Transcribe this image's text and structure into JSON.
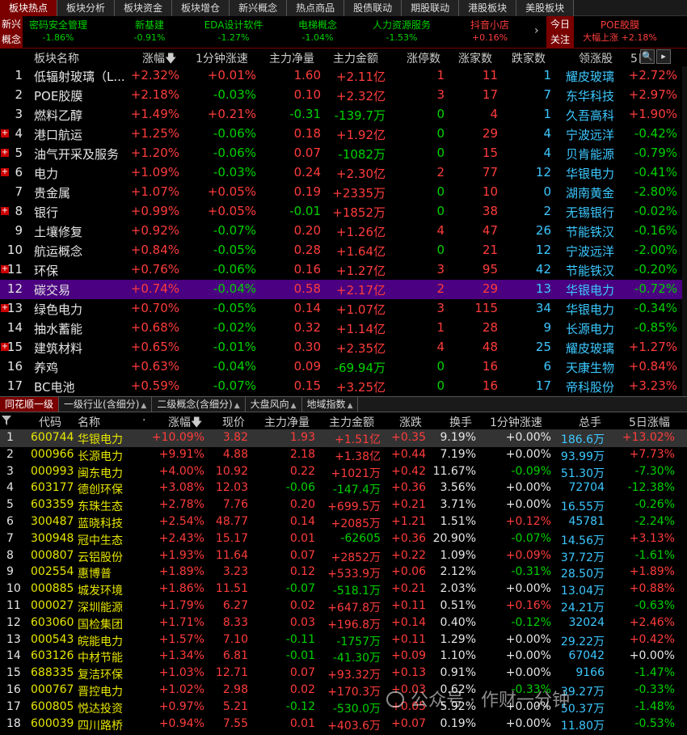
{
  "top_tabs": [
    "板块热点",
    "板块分析",
    "板块资金",
    "板块增仓",
    "新兴概念",
    "热点商品",
    "股债联动",
    "期股联动",
    "港股板块",
    "美股板块"
  ],
  "ticker": {
    "left_label_line1": "新兴",
    "left_label_line2": "概念",
    "items": [
      {
        "name": "密码安全管理",
        "value": "-1.86%"
      },
      {
        "name": "新基建",
        "value": "-0.91%"
      },
      {
        "name": "EDA设计软件",
        "value": "-1.27%"
      },
      {
        "name": "电梯概念",
        "value": "-1.04%"
      },
      {
        "name": "人力资源服务",
        "value": "-1.53%"
      },
      {
        "name": "抖音小店",
        "value": "+0.16%"
      }
    ],
    "right_label_line1": "今日",
    "right_label_line2": "关注",
    "hot_name": "POE胶膜",
    "hot_value": "大幅上涨 +2.18%"
  },
  "upper_headers": [
    "板块名称",
    "涨幅",
    "1分钟涨速",
    "主力净量",
    "主力金额",
    "涨停数",
    "涨家数",
    "跌家数",
    "领涨股",
    "5日"
  ],
  "upper_rows": [
    {
      "n": "1",
      "name": "低辐射玻璃（L...",
      "chg": "+2.32%",
      "spd": "+0.01%",
      "net": "1.60",
      "amt": "+2.11亿",
      "lu": "1",
      "up": "11",
      "dn": "1",
      "lead": "耀皮玻璃",
      "lchg": "+2.72%",
      "exp": false
    },
    {
      "n": "2",
      "name": "POE胶膜",
      "chg": "+2.18%",
      "spd": "-0.03%",
      "net": "0.10",
      "amt": "+2.32亿",
      "lu": "3",
      "up": "17",
      "dn": "7",
      "lead": "东华科技",
      "lchg": "+2.97%",
      "exp": false
    },
    {
      "n": "3",
      "name": "燃料乙醇",
      "chg": "+1.49%",
      "spd": "+0.21%",
      "net": "-0.31",
      "amt": "-139.7万",
      "lu": "0",
      "up": "4",
      "dn": "1",
      "lead": "久吾高科",
      "lchg": "+1.90%",
      "exp": false
    },
    {
      "n": "4",
      "name": "港口航运",
      "chg": "+1.25%",
      "spd": "-0.06%",
      "net": "0.18",
      "amt": "+1.92亿",
      "lu": "0",
      "up": "29",
      "dn": "4",
      "lead": "宁波远洋",
      "lchg": "-0.42%",
      "exp": true
    },
    {
      "n": "5",
      "name": "油气开采及服务",
      "chg": "+1.20%",
      "spd": "-0.06%",
      "net": "0.07",
      "amt": "-1082万",
      "lu": "0",
      "up": "15",
      "dn": "4",
      "lead": "贝肯能源",
      "lchg": "-0.79%",
      "exp": true
    },
    {
      "n": "6",
      "name": "电力",
      "chg": "+1.09%",
      "spd": "-0.03%",
      "net": "0.24",
      "amt": "+2.30亿",
      "lu": "2",
      "up": "77",
      "dn": "12",
      "lead": "华银电力",
      "lchg": "-0.41%",
      "exp": true
    },
    {
      "n": "7",
      "name": "贵金属",
      "chg": "+1.07%",
      "spd": "+0.05%",
      "net": "0.19",
      "amt": "+2335万",
      "lu": "0",
      "up": "10",
      "dn": "0",
      "lead": "湖南黄金",
      "lchg": "-2.80%",
      "exp": false
    },
    {
      "n": "8",
      "name": "银行",
      "chg": "+0.99%",
      "spd": "+0.05%",
      "net": "-0.01",
      "amt": "+1852万",
      "lu": "0",
      "up": "38",
      "dn": "2",
      "lead": "无锡银行",
      "lchg": "-0.02%",
      "exp": true
    },
    {
      "n": "9",
      "name": "土壤修复",
      "chg": "+0.92%",
      "spd": "-0.07%",
      "net": "0.20",
      "amt": "+1.26亿",
      "lu": "4",
      "up": "47",
      "dn": "26",
      "lead": "节能铁汉",
      "lchg": "-0.16%",
      "exp": false
    },
    {
      "n": "10",
      "name": "航运概念",
      "chg": "+0.84%",
      "spd": "-0.05%",
      "net": "0.28",
      "amt": "+1.64亿",
      "lu": "0",
      "up": "21",
      "dn": "12",
      "lead": "宁波远洋",
      "lchg": "-2.00%",
      "exp": false
    },
    {
      "n": "11",
      "name": "环保",
      "chg": "+0.76%",
      "spd": "-0.06%",
      "net": "0.16",
      "amt": "+1.27亿",
      "lu": "3",
      "up": "95",
      "dn": "42",
      "lead": "节能铁汉",
      "lchg": "-0.20%",
      "exp": true
    },
    {
      "n": "12",
      "name": "碳交易",
      "chg": "+0.74%",
      "spd": "-0.04%",
      "net": "0.58",
      "amt": "+2.17亿",
      "lu": "2",
      "up": "29",
      "dn": "13",
      "lead": "华银电力",
      "lchg": "-0.72%",
      "exp": false
    },
    {
      "n": "13",
      "name": "绿色电力",
      "chg": "+0.70%",
      "spd": "-0.05%",
      "net": "0.14",
      "amt": "+1.07亿",
      "lu": "3",
      "up": "115",
      "dn": "34",
      "lead": "华银电力",
      "lchg": "-0.34%",
      "exp": true
    },
    {
      "n": "14",
      "name": "抽水蓄能",
      "chg": "+0.68%",
      "spd": "-0.02%",
      "net": "0.32",
      "amt": "+1.14亿",
      "lu": "1",
      "up": "28",
      "dn": "9",
      "lead": "长源电力",
      "lchg": "-0.85%",
      "exp": false
    },
    {
      "n": "15",
      "name": "建筑材料",
      "chg": "+0.65%",
      "spd": "-0.01%",
      "net": "0.30",
      "amt": "+2.35亿",
      "lu": "4",
      "up": "48",
      "dn": "25",
      "lead": "耀皮玻璃",
      "lchg": "+1.27%",
      "exp": true
    },
    {
      "n": "16",
      "name": "养鸡",
      "chg": "+0.63%",
      "spd": "-0.04%",
      "net": "0.09",
      "amt": "-69.94万",
      "lu": "0",
      "up": "16",
      "dn": "6",
      "lead": "天康生物",
      "lchg": "+0.84%",
      "exp": false
    },
    {
      "n": "17",
      "name": "BC电池",
      "chg": "+0.59%",
      "spd": "-0.07%",
      "net": "0.15",
      "amt": "+3.25亿",
      "lu": "0",
      "up": "16",
      "dn": "17",
      "lead": "帝科股份",
      "lchg": "+3.23%",
      "exp": false
    }
  ],
  "mid_tabs": [
    "同花顺一级",
    "一级行业(含细分)",
    "二级概念(含细分)",
    "大盘风向",
    "地域指数"
  ],
  "lower_headers": [
    "代码",
    "名称",
    "·",
    "涨幅",
    "现价",
    "主力净量",
    "主力金额",
    "涨跌",
    "换手",
    "1分钟涨速",
    "总手",
    "5日涨幅"
  ],
  "lower_rows": [
    {
      "n": "1",
      "code": "600744",
      "name": "华银电力",
      "chg": "+10.09%",
      "price": "3.82",
      "net": "1.93",
      "amt": "+1.51亿",
      "diff": "+0.35",
      "turn": "9.19%",
      "spd": "+0.00%",
      "vol": "186.6万",
      "d5": "+13.02%"
    },
    {
      "n": "2",
      "code": "000966",
      "name": "长源电力",
      "chg": "+9.91%",
      "price": "4.88",
      "net": "2.18",
      "amt": "+1.38亿",
      "diff": "+0.44",
      "turn": "7.19%",
      "spd": "+0.00%",
      "vol": "93.99万",
      "d5": "+7.73%"
    },
    {
      "n": "3",
      "code": "000993",
      "name": "闽东电力",
      "chg": "+4.00%",
      "price": "10.92",
      "net": "0.22",
      "amt": "+1021万",
      "diff": "+0.42",
      "turn": "11.67%",
      "spd": "-0.09%",
      "vol": "51.30万",
      "d5": "-7.30%"
    },
    {
      "n": "4",
      "code": "603177",
      "name": "德创环保",
      "chg": "+3.08%",
      "price": "12.03",
      "net": "-0.06",
      "amt": "-147.4万",
      "diff": "+0.36",
      "turn": "3.56%",
      "spd": "+0.00%",
      "vol": "72704",
      "d5": "-12.38%"
    },
    {
      "n": "5",
      "code": "603359",
      "name": "东珠生态",
      "chg": "+2.78%",
      "price": "7.76",
      "net": "0.20",
      "amt": "+699.5万",
      "diff": "+0.21",
      "turn": "3.71%",
      "spd": "+0.00%",
      "vol": "16.55万",
      "d5": "-0.26%"
    },
    {
      "n": "6",
      "code": "300487",
      "name": "蓝晓科技",
      "chg": "+2.54%",
      "price": "48.77",
      "net": "0.14",
      "amt": "+2085万",
      "diff": "+1.21",
      "turn": "1.51%",
      "spd": "+0.12%",
      "vol": "45781",
      "d5": "-2.24%"
    },
    {
      "n": "7",
      "code": "300948",
      "name": "冠中生态",
      "chg": "+2.43%",
      "price": "15.17",
      "net": "0.01",
      "amt": "-62605",
      "diff": "+0.36",
      "turn": "20.90%",
      "spd": "-0.07%",
      "vol": "14.56万",
      "d5": "+3.13%"
    },
    {
      "n": "8",
      "code": "000807",
      "name": "云铝股份",
      "chg": "+1.93%",
      "price": "11.64",
      "net": "0.07",
      "amt": "+2852万",
      "diff": "+0.22",
      "turn": "1.09%",
      "spd": "+0.09%",
      "vol": "37.72万",
      "d5": "-1.61%"
    },
    {
      "n": "9",
      "code": "002554",
      "name": "惠博普",
      "chg": "+1.89%",
      "price": "3.23",
      "net": "0.12",
      "amt": "+533.9万",
      "diff": "+0.06",
      "turn": "2.12%",
      "spd": "-0.31%",
      "vol": "28.50万",
      "d5": "+1.89%"
    },
    {
      "n": "10",
      "code": "000885",
      "name": "城发环境",
      "chg": "+1.86%",
      "price": "11.51",
      "net": "-0.07",
      "amt": "-518.1万",
      "diff": "+0.21",
      "turn": "2.03%",
      "spd": "+0.00%",
      "vol": "13.04万",
      "d5": "+0.88%"
    },
    {
      "n": "11",
      "code": "000027",
      "name": "深圳能源",
      "chg": "+1.79%",
      "price": "6.27",
      "net": "0.02",
      "amt": "+647.8万",
      "diff": "+0.11",
      "turn": "0.51%",
      "spd": "+0.16%",
      "vol": "24.21万",
      "d5": "-0.63%"
    },
    {
      "n": "12",
      "code": "603060",
      "name": "国检集团",
      "chg": "+1.71%",
      "price": "8.33",
      "net": "0.03",
      "amt": "+196.8万",
      "diff": "+0.14",
      "turn": "0.40%",
      "spd": "-0.12%",
      "vol": "32024",
      "d5": "+2.46%"
    },
    {
      "n": "13",
      "code": "000543",
      "name": "皖能电力",
      "chg": "+1.57%",
      "price": "7.10",
      "net": "-0.11",
      "amt": "-1757万",
      "diff": "+0.11",
      "turn": "1.29%",
      "spd": "+0.00%",
      "vol": "29.22万",
      "d5": "+0.42%"
    },
    {
      "n": "14",
      "code": "603126",
      "name": "中材节能",
      "chg": "+1.34%",
      "price": "6.81",
      "net": "-0.01",
      "amt": "-41.30万",
      "diff": "+0.09",
      "turn": "1.10%",
      "spd": "+0.00%",
      "vol": "67042",
      "d5": "+0.00%"
    },
    {
      "n": "15",
      "code": "688335",
      "name": "复洁环保",
      "chg": "+1.03%",
      "price": "12.71",
      "net": "0.07",
      "amt": "+93.32万",
      "diff": "+0.13",
      "turn": "0.91%",
      "spd": "+0.00%",
      "vol": "9166",
      "d5": "-1.47%"
    },
    {
      "n": "16",
      "code": "000767",
      "name": "晋控电力",
      "chg": "+1.02%",
      "price": "2.98",
      "net": "0.02",
      "amt": "+170.3万",
      "diff": "+0.03",
      "turn": "0.62%",
      "spd": "-0.33%",
      "vol": "39.27万",
      "d5": "-0.33%"
    },
    {
      "n": "17",
      "code": "600805",
      "name": "悦达投资",
      "chg": "+0.97%",
      "price": "5.21",
      "net": "-0.12",
      "amt": "-530.0万",
      "diff": "+0.05",
      "turn": "5.92%",
      "spd": "+0.00%",
      "vol": "50.37万",
      "d5": "-1.48%"
    },
    {
      "n": "18",
      "code": "600039",
      "name": "四川路桥",
      "chg": "+0.94%",
      "price": "7.55",
      "net": "0.01",
      "amt": "+403.6万",
      "diff": "+0.07",
      "turn": "0.19%",
      "spd": "+0.00%",
      "vol": "11.80万",
      "d5": "-0.53%"
    }
  ],
  "watermark": "公众号 · 作财一分钟",
  "colors": {
    "up": "#ff3c3c",
    "down": "#00d200",
    "cyan": "#3cc8ff",
    "selected_row": "#4a0080",
    "tab_active": "#7a0000"
  }
}
